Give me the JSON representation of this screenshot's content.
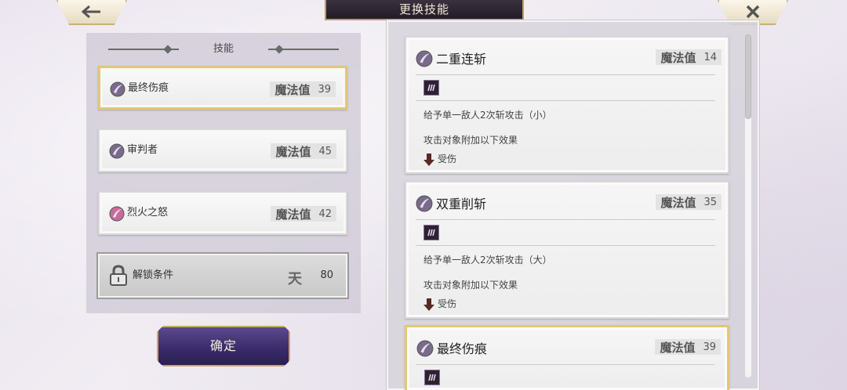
{
  "header": {
    "title": "更换技能",
    "back_symbol": "🡐",
    "close_symbol": "✕"
  },
  "left_panel": {
    "heading": "技能",
    "slots": [
      {
        "name": "最终伤痕",
        "mp_label": "魔法值",
        "mp": "39",
        "orb": "purple",
        "selected": true
      },
      {
        "name": "审判者",
        "mp_label": "魔法值",
        "mp": "45",
        "orb": "purple",
        "selected": false
      },
      {
        "name": "烈火之怒",
        "mp_label": "魔法值",
        "mp": "42",
        "orb": "pink",
        "selected": false
      }
    ],
    "locked": {
      "label": "解锁条件",
      "glyph": "天",
      "value": "80"
    }
  },
  "confirm_label": "确定",
  "skills": [
    {
      "name": "二重连斩",
      "mp_label": "魔法值",
      "mp": "14",
      "desc": "给予单一敌人2次斩攻击（小）",
      "effect": "攻击对象附加以下效果",
      "debuff": "受伤"
    },
    {
      "name": "双重削斩",
      "mp_label": "魔法值",
      "mp": "35",
      "desc": "给予单一敌人2次斩攻击（大）",
      "effect": "攻击对象附加以下效果",
      "debuff": "受伤"
    },
    {
      "name": "最终伤痕",
      "mp_label": "魔法值",
      "mp": "39",
      "desc": "",
      "effect": "",
      "debuff": ""
    }
  ],
  "colors": {
    "accent_gold": "#e2c779",
    "button_purple": "#3b2c6b",
    "orb_purple": "#7a6a8c",
    "orb_pink": "#c86b9a"
  }
}
